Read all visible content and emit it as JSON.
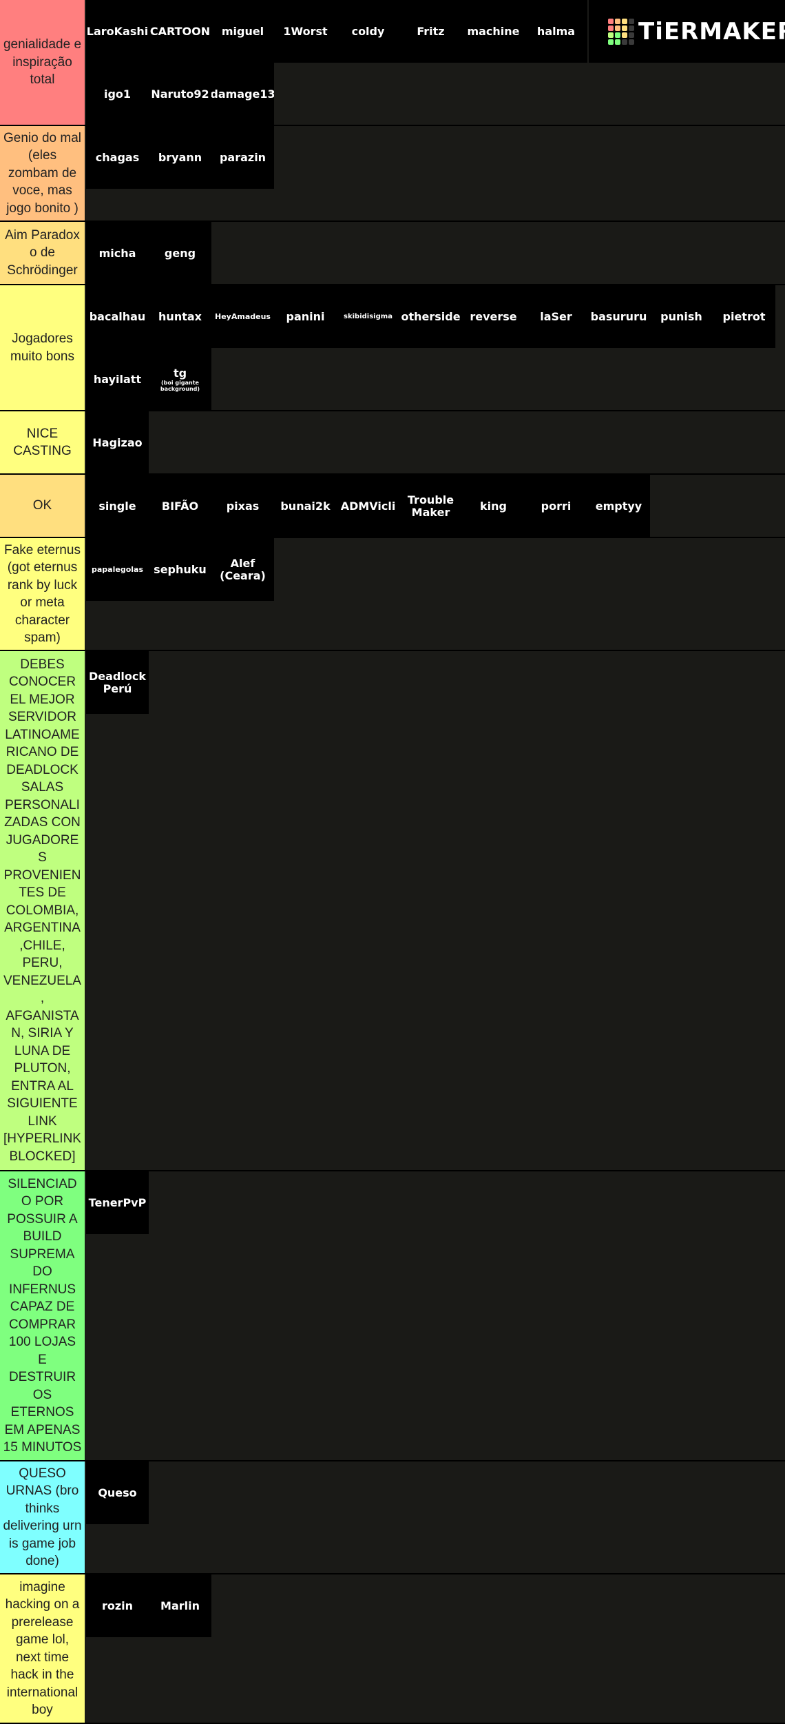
{
  "logo": {
    "text": "TiERMAKER",
    "grid_colors": [
      "#ff7f7f",
      "#ffbf7f",
      "#ffdf7f",
      "#3a3a3a",
      "#ff7f7f",
      "#ffbf7f",
      "#ffdf7f",
      "#3a3a3a",
      "#bfff7f",
      "#7fff7f",
      "#ffdf7f",
      "#3a3a3a",
      "#7fff7f",
      "#7fff7f",
      "#3a3a3a",
      "#3a3a3a"
    ]
  },
  "tiers": [
    {
      "label": "genialidade e inspiração total",
      "color": "#ff7f7f",
      "items": [
        {
          "label": "LaroKashi"
        },
        {
          "label": "CARTOON"
        },
        {
          "label": "miguel"
        },
        {
          "label": "1Worst"
        },
        {
          "label": "coldy"
        },
        {
          "label": "Fritz"
        },
        {
          "label": "machine"
        },
        {
          "label": "halma"
        },
        {
          "label": "igo1"
        },
        {
          "label": "Naruto92"
        },
        {
          "label": "damage13"
        }
      ]
    },
    {
      "label": "Genio do mal (eles zombam de voce, mas jogo bonito )",
      "color": "#ffbf7f",
      "items": [
        {
          "label": "chagas"
        },
        {
          "label": "bryann"
        },
        {
          "label": "parazin"
        }
      ]
    },
    {
      "label": "Aim Paradox o de Schrödinger",
      "color": "#ffdf7f",
      "items": [
        {
          "label": "micha"
        },
        {
          "label": "geng"
        }
      ]
    },
    {
      "label": "Jogadores muito bons",
      "color": "#ffff7f",
      "items": [
        {
          "label": "bacalhau"
        },
        {
          "label": "huntax"
        },
        {
          "label": "HeyAmadeus",
          "size": "small"
        },
        {
          "label": "panini"
        },
        {
          "label": "skibidisigma",
          "size": "tiny"
        },
        {
          "label": "otherside"
        },
        {
          "label": "reverse"
        },
        {
          "label": "laSer"
        },
        {
          "label": "basururu"
        },
        {
          "label": "punish"
        },
        {
          "label": "pietrot"
        },
        {
          "label": "hayilatt"
        },
        {
          "label": "tg",
          "sub": "(boi gigante background)"
        }
      ]
    },
    {
      "label": "NICE CASTING",
      "color": "#ffff7f",
      "items": [
        {
          "label": "Hagizao"
        }
      ]
    },
    {
      "label": "OK",
      "color": "#ffdf7f",
      "items": [
        {
          "label": "single"
        },
        {
          "label": "BIFÃO"
        },
        {
          "label": "pixas"
        },
        {
          "label": "bunai2k"
        },
        {
          "label": "ADMVicli"
        },
        {
          "label": "Trouble Maker"
        },
        {
          "label": "king"
        },
        {
          "label": "porri"
        },
        {
          "label": "emptyy"
        }
      ]
    },
    {
      "label": "Fake eternus (got eternus rank by luck or meta character spam)",
      "color": "#ffff7f",
      "items": [
        {
          "label": "papalegolas",
          "size": "small"
        },
        {
          "label": "sephuku"
        },
        {
          "label": "Alef (Ceara)"
        }
      ]
    },
    {
      "label": "DEBES CONOCER EL MEJOR SERVIDOR LATINOAMERICANO DE DEADLOCKSALAS PERSONALIZADAS CON JUGADORES PROVENIENTES DE COLOMBIA, ARGENTINA,CHILE, PERU, VENEZUELA, AFGANISTAN, SIRIA Y LUNA DE PLUTON, ENTRA AL SIGUIENTE LINK [HYPERLINK BLOCKED]",
      "color": "#bfff7f",
      "items": [
        {
          "label": "Deadlock Perú"
        }
      ]
    },
    {
      "label": "SILENCIADO POR POSSUIR A BUILD SUPREMA DO INFERNUS CAPAZ DE COMPRAR 100 LOJAS E DESTRUIR OS ETERNOS EM APENAS 15 MINUTOS",
      "color": "#7fff7f",
      "items": [
        {
          "label": "TenerPvP"
        }
      ]
    },
    {
      "label": "QUESO URNAS (bro thinks delivering urn is game job done)",
      "color": "#7fffff",
      "items": [
        {
          "label": "Queso"
        }
      ]
    },
    {
      "label": "imagine hacking on a prerelease game lol, next time hack in the international boy",
      "color": "#ffff7f",
      "items": [
        {
          "label": "rozin"
        },
        {
          "label": "Marlin"
        }
      ]
    }
  ]
}
